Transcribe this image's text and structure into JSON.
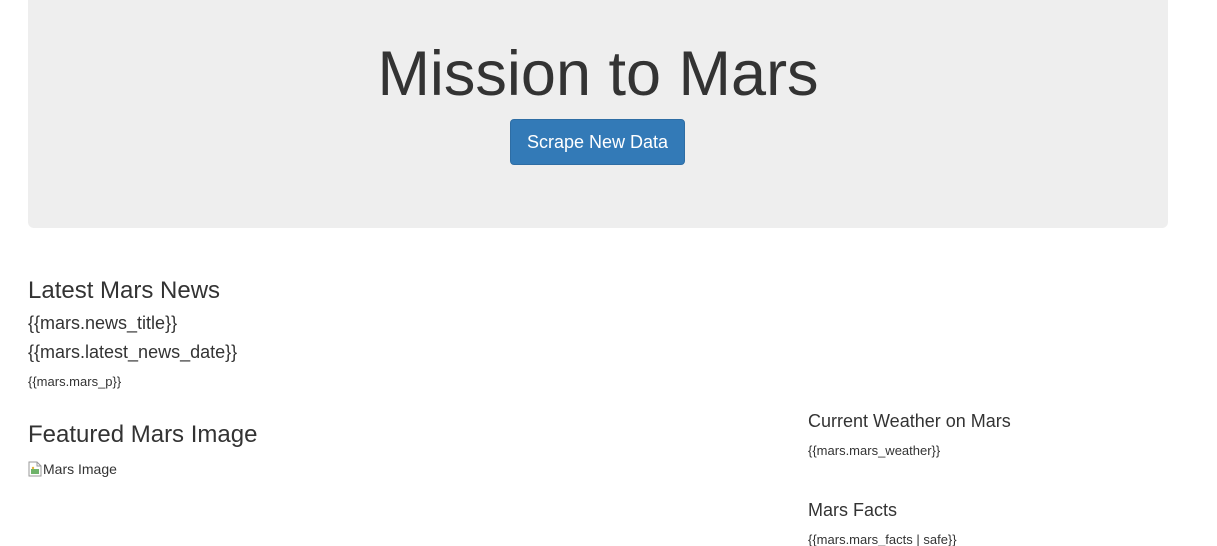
{
  "header": {
    "title": "Mission to Mars",
    "scrape_button_label": "Scrape New Data",
    "background_color": "#eeeeee",
    "button_color": "#337ab7"
  },
  "news": {
    "heading": "Latest Mars News",
    "title": "{{mars.news_title}}",
    "date": "{{mars.latest_news_date}}",
    "paragraph": "{{mars.mars_p}}"
  },
  "featured_image": {
    "heading": "Featured Mars Image",
    "alt_text": "Mars Image",
    "icon": "broken-image-icon"
  },
  "weather": {
    "heading": "Current Weather on Mars",
    "value": "{{mars.mars_weather}}"
  },
  "facts": {
    "heading": "Mars Facts",
    "value": "{{mars.mars_facts | safe}}"
  }
}
